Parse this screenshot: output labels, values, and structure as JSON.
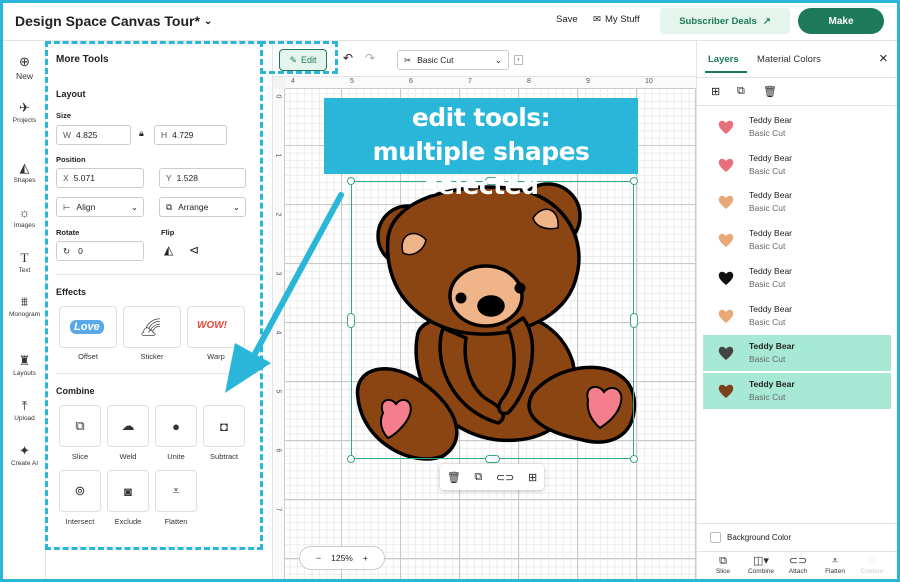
{
  "header": {
    "title": "Design Space Canvas Tour*",
    "save": "Save",
    "my_stuff": "My Stuff",
    "deals": "Subscriber Deals",
    "make": "Make"
  },
  "rail": {
    "new": "New",
    "projects": "Projects",
    "shapes": "Shapes",
    "images": "Images",
    "text": "Text",
    "monogram": "Monogram",
    "layouts": "Layouts",
    "upload": "Upload",
    "create_ai": "Create AI"
  },
  "panel": {
    "title": "More Tools",
    "layout": "Layout",
    "size": "Size",
    "w_key": "W",
    "w": "4.825",
    "h_key": "H",
    "h": "4.729",
    "position": "Position",
    "x_key": "X",
    "x": "5.071",
    "y_key": "Y",
    "y": "1.528",
    "align": "Align",
    "arrange": "Arrange",
    "rotate": "Rotate",
    "rotate_value": "0",
    "flip": "Flip",
    "effects": "Effects",
    "effects_items": [
      "Offset",
      "Sticker",
      "Warp"
    ],
    "offset_art": "Love",
    "warp_art": "WOW!",
    "combine": "Combine",
    "combine_items": [
      "Slice",
      "Weld",
      "Unite",
      "Subtract",
      "Intersect",
      "Exclude",
      "Flatten"
    ]
  },
  "toolbar": {
    "edit": "Edit",
    "operation": "Basic Cut"
  },
  "rulers": {
    "top": [
      "4",
      "5",
      "6",
      "7",
      "8",
      "9",
      "10"
    ],
    "left": [
      "0",
      "1",
      "2",
      "3",
      "4",
      "5",
      "6",
      "7"
    ]
  },
  "banner": {
    "line1": "edit tools:",
    "line2": "multiple shapes selected"
  },
  "zoom": {
    "minus": "−",
    "value": "125%",
    "plus": "+"
  },
  "right_panel": {
    "tab_layers": "Layers",
    "tab_colors": "Material Colors",
    "layers": [
      {
        "name": "Teddy Bear",
        "sub": "Basic Cut",
        "color": "#e8707a",
        "selected": false
      },
      {
        "name": "Teddy Bear",
        "sub": "Basic Cut",
        "color": "#e8707a",
        "selected": false
      },
      {
        "name": "Teddy Bear",
        "sub": "Basic Cut",
        "color": "#e9a877",
        "selected": false
      },
      {
        "name": "Teddy Bear",
        "sub": "Basic Cut",
        "color": "#e9a877",
        "selected": false
      },
      {
        "name": "Teddy Bear",
        "sub": "Basic Cut",
        "color": "#111111",
        "selected": false
      },
      {
        "name": "Teddy Bear",
        "sub": "Basic Cut",
        "color": "#e9a877",
        "selected": false
      },
      {
        "name": "Teddy Bear",
        "sub": "Basic Cut",
        "color": "#444444",
        "selected": true
      },
      {
        "name": "Teddy Bear",
        "sub": "Basic Cut",
        "color": "#7b3f1a",
        "selected": true
      }
    ],
    "background_color": "Background Color",
    "bottom": [
      "Slice",
      "Combine",
      "Attach",
      "Flatten",
      "Contour"
    ]
  },
  "colors": {
    "accent": "#29b6d9",
    "brand": "#1c7a5a",
    "bear_brown": "#8b4513",
    "bear_tan": "#f0b489",
    "heart_pink": "#f47f8b"
  }
}
